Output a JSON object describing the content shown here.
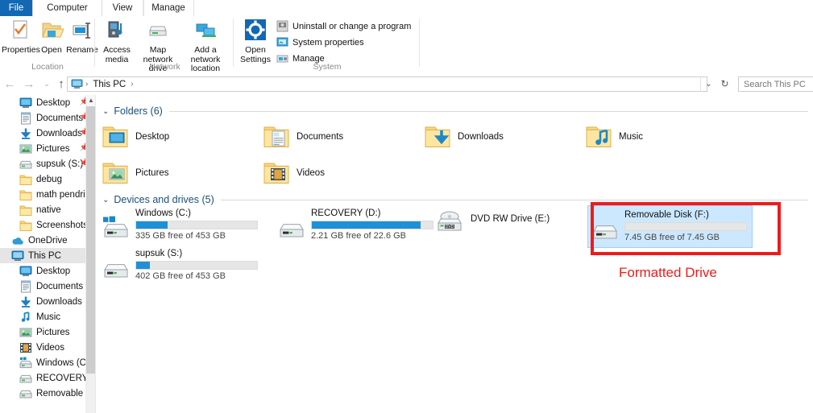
{
  "window": {
    "tabs": [
      {
        "label": "File",
        "state": "file"
      },
      {
        "label": "Computer",
        "state": "selected"
      },
      {
        "label": "View",
        "state": "normal"
      },
      {
        "label": "Manage",
        "state": "normal"
      }
    ]
  },
  "ribbon": {
    "groups": [
      {
        "name": "Location",
        "buttons": [
          {
            "label": "Properties",
            "icon": "properties-icon"
          },
          {
            "label": "Open",
            "icon": "open-folder-icon"
          },
          {
            "label": "Rename",
            "icon": "rename-icon"
          }
        ]
      },
      {
        "name": "Network",
        "buttons": [
          {
            "label": "Access media",
            "icon": "access-media-icon",
            "dropdown": true
          },
          {
            "label": "Map network drive",
            "icon": "map-network-drive-icon",
            "dropdown": true
          },
          {
            "label": "Add a network location",
            "icon": "add-network-location-icon",
            "dropdown": false
          }
        ]
      },
      {
        "name": "System",
        "buttons": [
          {
            "label": "Open Settings",
            "icon": "gear-icon"
          }
        ],
        "items": [
          {
            "label": "Uninstall or change a program",
            "icon": "uninstall-icon"
          },
          {
            "label": "System properties",
            "icon": "system-properties-icon"
          },
          {
            "label": "Manage",
            "icon": "manage-icon"
          }
        ]
      }
    ]
  },
  "addressbar": {
    "back_icon": "back-arrow-icon",
    "forward_icon": "forward-arrow-icon",
    "recent_icon": "chevron-down-icon",
    "up_icon": "up-arrow-icon",
    "breadcrumb_icon": "this-pc-icon",
    "breadcrumb": "This PC",
    "separator": "›",
    "dropdown_icon": "chevron-down-icon",
    "refresh_icon": "refresh-icon",
    "search_placeholder": "Search This PC"
  },
  "sidebar": {
    "items": [
      {
        "label": "Desktop",
        "icon": "desktop-icon",
        "indent": 1,
        "pinned": true,
        "selected": false
      },
      {
        "label": "Documents",
        "icon": "documents-icon",
        "indent": 1,
        "pinned": true,
        "selected": false
      },
      {
        "label": "Downloads",
        "icon": "downloads-icon",
        "indent": 1,
        "pinned": true,
        "selected": false
      },
      {
        "label": "Pictures",
        "icon": "pictures-icon",
        "indent": 1,
        "pinned": true,
        "selected": false
      },
      {
        "label": "supsuk (S:)",
        "icon": "drive-icon",
        "indent": 1,
        "pinned": true,
        "selected": false
      },
      {
        "label": "debug",
        "icon": "folder-icon",
        "indent": 1,
        "pinned": false,
        "selected": false
      },
      {
        "label": "math pendrive",
        "icon": "folder-icon",
        "indent": 1,
        "pinned": false,
        "selected": false
      },
      {
        "label": "native",
        "icon": "folder-icon",
        "indent": 1,
        "pinned": false,
        "selected": false
      },
      {
        "label": "Screenshots",
        "icon": "folder-icon",
        "indent": 1,
        "pinned": false,
        "selected": false
      },
      {
        "label": "OneDrive",
        "icon": "onedrive-icon",
        "indent": 0,
        "pinned": false,
        "selected": false
      },
      {
        "label": "This PC",
        "icon": "this-pc-icon",
        "indent": 0,
        "pinned": false,
        "selected": true
      },
      {
        "label": "Desktop",
        "icon": "desktop-icon",
        "indent": 1,
        "pinned": false,
        "selected": false
      },
      {
        "label": "Documents",
        "icon": "documents-icon",
        "indent": 1,
        "pinned": false,
        "selected": false
      },
      {
        "label": "Downloads",
        "icon": "downloads-icon",
        "indent": 1,
        "pinned": false,
        "selected": false
      },
      {
        "label": "Music",
        "icon": "music-icon",
        "indent": 1,
        "pinned": false,
        "selected": false
      },
      {
        "label": "Pictures",
        "icon": "pictures-icon",
        "indent": 1,
        "pinned": false,
        "selected": false
      },
      {
        "label": "Videos",
        "icon": "videos-icon",
        "indent": 1,
        "pinned": false,
        "selected": false
      },
      {
        "label": "Windows (C:)",
        "icon": "windows-drive-icon",
        "indent": 1,
        "pinned": false,
        "selected": false
      },
      {
        "label": "RECOVERY (D:)",
        "icon": "drive-icon",
        "indent": 1,
        "pinned": false,
        "selected": false
      },
      {
        "label": "Removable Disk",
        "icon": "drive-icon",
        "indent": 1,
        "pinned": false,
        "selected": false
      }
    ]
  },
  "main": {
    "folders_group": {
      "title": "Folders (6)",
      "chevron": "⌄",
      "items": [
        {
          "label": "Desktop",
          "icon": "folder-desktop-icon"
        },
        {
          "label": "Documents",
          "icon": "folder-documents-icon"
        },
        {
          "label": "Downloads",
          "icon": "folder-downloads-icon"
        },
        {
          "label": "Music",
          "icon": "folder-music-icon"
        },
        {
          "label": "Pictures",
          "icon": "folder-pictures-icon"
        },
        {
          "label": "Videos",
          "icon": "folder-videos-icon"
        }
      ]
    },
    "drives_group": {
      "title": "Devices and drives (5)",
      "chevron": "⌄",
      "items": [
        {
          "name": "Windows (C:)",
          "free": "335 GB free of 453 GB",
          "used_pct": 26,
          "icon": "windows-drive-icon",
          "selected": false,
          "has_bar": true
        },
        {
          "name": "RECOVERY (D:)",
          "free": "2.21 GB free of 22.6 GB",
          "used_pct": 90,
          "icon": "drive-icon",
          "selected": false,
          "has_bar": true
        },
        {
          "name": "DVD RW Drive (E:)",
          "free": "",
          "used_pct": 0,
          "icon": "dvd-drive-icon",
          "selected": false,
          "has_bar": false
        },
        {
          "name": "Removable Disk (F:)",
          "free": "7.45 GB free of 7.45 GB",
          "used_pct": 0,
          "icon": "removable-drive-icon",
          "selected": true,
          "has_bar": true
        },
        {
          "name": "supsuk (S:)",
          "free": "402 GB free of 453 GB",
          "used_pct": 11,
          "icon": "drive-icon",
          "selected": false,
          "has_bar": true
        }
      ]
    }
  },
  "annotation": {
    "label": "Formatted Drive",
    "color": "#ee1b1b"
  }
}
